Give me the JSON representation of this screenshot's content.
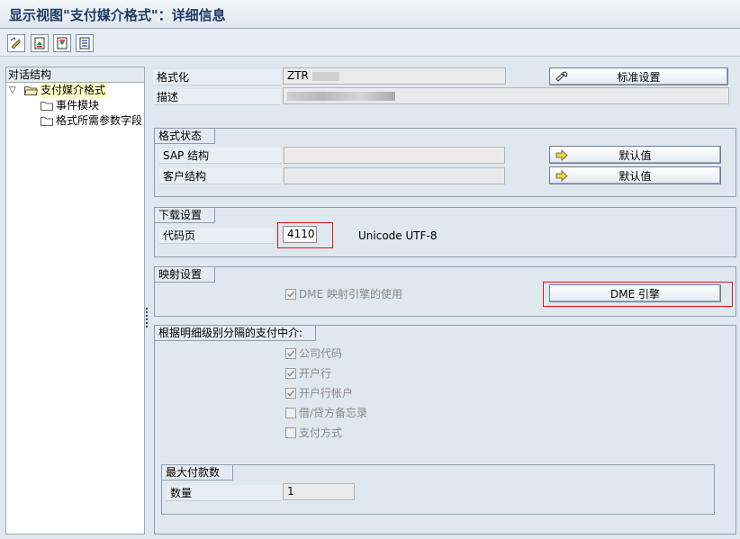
{
  "window": {
    "title": "显示视图\"支付媒介格式\"：详细信息"
  },
  "toolbar": {
    "buttons": [
      {
        "icon": "display-change-icon"
      },
      {
        "icon": "previous-entry-icon"
      },
      {
        "icon": "next-entry-icon"
      },
      {
        "icon": "select-all-icon"
      }
    ]
  },
  "tree": {
    "header": "对话结构",
    "items": [
      {
        "label": "支付媒介格式",
        "level": 0,
        "expanded": true,
        "selected": true
      },
      {
        "label": "事件模块",
        "level": 1
      },
      {
        "label": "格式所需参数字段",
        "level": 1
      }
    ]
  },
  "header_fields": {
    "format_label": "格式化",
    "format_value": "ZTR",
    "description_label": "描述",
    "description_value": "",
    "standard_settings_button": "标准设置"
  },
  "format_status": {
    "title": "格式状态",
    "sap_structure_label": "SAP 结构",
    "customer_structure_label": "客户结构",
    "default_button_1": "默认值",
    "default_button_2": "默认值"
  },
  "download_settings": {
    "title": "下载设置",
    "code_page_label": "代码页",
    "code_page_value": "4110",
    "encoding_text": "Unicode UTF-8"
  },
  "mapping_settings": {
    "title": "映射设置",
    "dme_checkbox_label": "DME 映射引擎的使用",
    "dme_checkbox_checked": true,
    "dme_button": "DME 引擎"
  },
  "separation": {
    "title": "根据明细级别分隔的支付中介:",
    "options": [
      {
        "label": "公司代码",
        "checked": true
      },
      {
        "label": "开户行",
        "checked": true
      },
      {
        "label": "开户行帐户",
        "checked": true
      },
      {
        "label": "借/贷方备忘录",
        "checked": false
      },
      {
        "label": "支付方式",
        "checked": false
      }
    ],
    "max_payments": {
      "title": "最大付款数",
      "quantity_label": "数量",
      "quantity_value": "1"
    }
  },
  "colors": {
    "title_text": "#1c3a66",
    "highlight_red": "#e01515",
    "selected_tree_bg": "#ffffc7",
    "screen_bg": "#dfe7ef"
  }
}
